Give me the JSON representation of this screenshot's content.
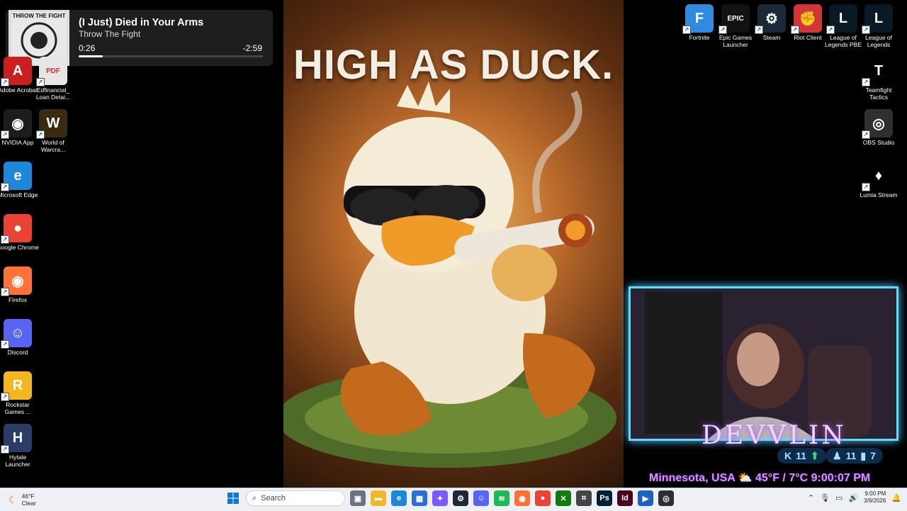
{
  "media": {
    "title": "(I Just) Died in Your Arms",
    "artist": "Throw The Fight",
    "current_time": "0:26",
    "remaining_time": "-2:59",
    "progress": 0.13,
    "art_text": "THROW THE FIGHT"
  },
  "desktop_left": [
    {
      "label": "Adobe Acrobat",
      "icon": "acrobat-icon",
      "color": "#c91f1f",
      "glyph": "A"
    },
    {
      "label": "Edfinancial_ Loan Detai...",
      "icon": "pdf-icon",
      "color": "#e6e6e6",
      "glyph": "PDF"
    },
    {
      "label": "NVIDIA App",
      "icon": "nvidia-icon",
      "color": "#1c1c1c",
      "glyph": "◉"
    },
    {
      "label": "World of Warcra...",
      "icon": "wow-icon",
      "color": "#3a2a12",
      "glyph": "W"
    },
    {
      "label": "Microsoft Edge",
      "icon": "edge-icon",
      "color": "#1e88d8",
      "glyph": "e"
    },
    {
      "label": "Google Chrome",
      "icon": "chrome-icon",
      "color": "#ea4335",
      "glyph": "●"
    },
    {
      "label": "Firefox",
      "icon": "firefox-icon",
      "color": "#ff7139",
      "glyph": "◉"
    },
    {
      "label": "Discord",
      "icon": "discord-icon",
      "color": "#5865f2",
      "glyph": "☺"
    },
    {
      "label": "Rockstar Games ...",
      "icon": "rockstar-icon",
      "color": "#f3b61f",
      "glyph": "R"
    },
    {
      "label": "Hytale Launcher",
      "icon": "hytale-icon",
      "color": "#2a3d66",
      "glyph": "H"
    }
  ],
  "desktop_right": [
    {
      "label": "Fortnite",
      "icon": "fortnite-icon",
      "color": "#2f8ae0",
      "glyph": "F"
    },
    {
      "label": "Epic Games Launcher",
      "icon": "epic-icon",
      "color": "#121212",
      "glyph": "EPIC"
    },
    {
      "label": "Steam",
      "icon": "steam-icon",
      "color": "#1b2838",
      "glyph": "⚙"
    },
    {
      "label": "Riot Client",
      "icon": "riot-icon",
      "color": "#d13639",
      "glyph": "✊"
    },
    {
      "label": "League of Legends PBE",
      "icon": "league-pbe-icon",
      "color": "#0a1a24",
      "glyph": "L"
    },
    {
      "label": "League of Legends",
      "icon": "league-icon",
      "color": "#0a1a24",
      "glyph": "L"
    },
    {
      "label": "Teamfight Tactics",
      "icon": "tft-icon",
      "color": "#000000",
      "glyph": "T"
    },
    {
      "label": "OBS Studio",
      "icon": "obs-icon",
      "color": "#302e31",
      "glyph": "◎"
    },
    {
      "label": "Lumia Stream",
      "icon": "lumia-icon",
      "color": "#000000",
      "glyph": "♦"
    }
  ],
  "wallpaper": {
    "headline": "HIGH AS DUCK."
  },
  "stream_overlay": {
    "name": "DEVVLIN",
    "stat_a": "11",
    "stat_b": "11",
    "stat_c": "7",
    "weather_line": "Minnesota, USA  ⛅  45°F / 7°C  9:00:07 PM"
  },
  "taskbar": {
    "weather_temp": "46°F",
    "weather_cond": "Clear",
    "search_placeholder": "Search",
    "apps": [
      {
        "name": "task-view-icon",
        "color": "#6b7280",
        "glyph": "▣"
      },
      {
        "name": "file-explorer-icon",
        "color": "#f2b82c",
        "glyph": "▬"
      },
      {
        "name": "edge-taskbar-icon",
        "color": "#1e88d8",
        "glyph": "e"
      },
      {
        "name": "store-icon",
        "color": "#2b6fd6",
        "glyph": "▦"
      },
      {
        "name": "copilot-icon",
        "color": "#7a5af8",
        "glyph": "✦"
      },
      {
        "name": "steam-taskbar-icon",
        "color": "#1b2838",
        "glyph": "⚙"
      },
      {
        "name": "discord-taskbar-icon",
        "color": "#5865f2",
        "glyph": "☺"
      },
      {
        "name": "spotify-icon",
        "color": "#1db954",
        "glyph": "≋"
      },
      {
        "name": "firefox-taskbar-icon",
        "color": "#ff7139",
        "glyph": "◉"
      },
      {
        "name": "chrome-taskbar-icon",
        "color": "#ea4335",
        "glyph": "●"
      },
      {
        "name": "xbox-icon",
        "color": "#107c10",
        "glyph": "✕"
      },
      {
        "name": "capture-icon",
        "color": "#444444",
        "glyph": "⌗"
      },
      {
        "name": "photoshop-icon",
        "color": "#001e36",
        "glyph": "Ps"
      },
      {
        "name": "indesign-icon",
        "color": "#49021f",
        "glyph": "Id"
      },
      {
        "name": "app-blue-icon",
        "color": "#1e5fc2",
        "glyph": "▶"
      },
      {
        "name": "obs-taskbar-icon",
        "color": "#302e31",
        "glyph": "◎"
      }
    ],
    "time": "9:00 PM",
    "date": "3/9/2026"
  }
}
